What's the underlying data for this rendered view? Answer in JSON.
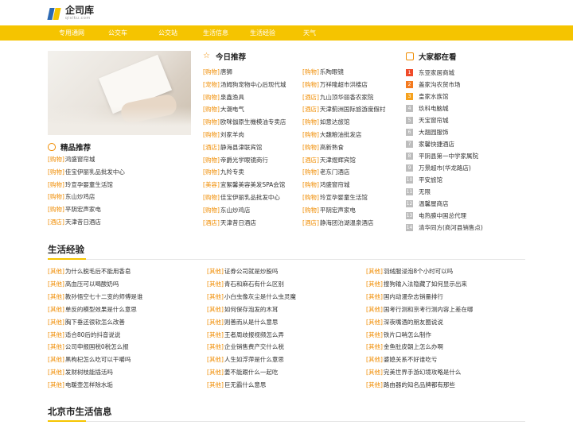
{
  "logo": {
    "title": "企司库",
    "subtitle": "qisiku.com"
  },
  "nav": [
    "专用通网",
    "公交车",
    "公交站",
    "生活信息",
    "生活经验",
    "天气"
  ],
  "jingpin": {
    "title": "精品推荐",
    "items": [
      {
        "tag": "购物",
        "text": "鸿盛窗帘城"
      },
      {
        "tag": "购物",
        "text": "佳宝伊丽乳品批发中心"
      },
      {
        "tag": "购物",
        "text": "玲宣孕婴童生活馆"
      },
      {
        "tag": "购物",
        "text": "东山炒鸡店"
      },
      {
        "tag": "购物",
        "text": "平阴宏声家电"
      },
      {
        "tag": "酒店",
        "text": "天津昔日酒店"
      }
    ]
  },
  "today": {
    "title": "今日推荐",
    "left": [
      {
        "tag": "购物",
        "text": "唐狮"
      },
      {
        "tag": "宠物",
        "text": "汤姆狗宠物中心后现代城"
      },
      {
        "tag": "购物",
        "text": "泉鑫渔具"
      },
      {
        "tag": "购物",
        "text": "大潮电气"
      },
      {
        "tag": "购物",
        "text": "欧咪伽原生機模油专卖店"
      },
      {
        "tag": "购物",
        "text": "刘家羊肉"
      },
      {
        "tag": "酒店",
        "text": "静海县津联宾馆"
      },
      {
        "tag": "购物",
        "text": "帝爵光学眼镜商行"
      },
      {
        "tag": "购物",
        "text": "九羚专卖"
      },
      {
        "tag": "美容",
        "text": "宜絮馨美容美发SPA会馆"
      },
      {
        "tag": "购物",
        "text": "佳宝伊丽乳品批发中心"
      },
      {
        "tag": "购物",
        "text": "东山炒鸡店"
      },
      {
        "tag": "酒店",
        "text": "天津昔日酒店"
      }
    ],
    "right": [
      {
        "tag": "购物",
        "text": "乐陶眼镜"
      },
      {
        "tag": "购物",
        "text": "万祥隆超市洪楼店"
      },
      {
        "tag": "酒店",
        "text": "九山顶华丽香农家院"
      },
      {
        "tag": "酒店",
        "text": "天津蓟洲国际旅游度假村"
      },
      {
        "tag": "购物",
        "text": "如意达旅馆"
      },
      {
        "tag": "购物",
        "text": "大魏粮油批发店"
      },
      {
        "tag": "购物",
        "text": "高新熟食"
      },
      {
        "tag": "酒店",
        "text": "天津煜辉宾馆"
      },
      {
        "tag": "购物",
        "text": "老东门酒店"
      },
      {
        "tag": "购物",
        "text": "鸿盛窗帘城"
      },
      {
        "tag": "购物",
        "text": "玲宣孕婴童生活馆"
      },
      {
        "tag": "购物",
        "text": "平阴宏声家电"
      },
      {
        "tag": "酒店",
        "text": "静海团泊湖温泉酒店"
      }
    ]
  },
  "hot": {
    "title": "大家都在看",
    "items": [
      {
        "n": "1",
        "text": "东亚家居商城"
      },
      {
        "n": "2",
        "text": "盖家沟农贸市场"
      },
      {
        "n": "3",
        "text": "皇家水族馆"
      },
      {
        "n": "4",
        "text": "玖科电脑城"
      },
      {
        "n": "5",
        "text": "天宝窗帘城"
      },
      {
        "n": "6",
        "text": "大翘园服饰"
      },
      {
        "n": "7",
        "text": "家馨快捷酒店"
      },
      {
        "n": "8",
        "text": "平阴县第一中学家属院"
      },
      {
        "n": "9",
        "text": "万景超市(华龙路店)"
      },
      {
        "n": "10",
        "text": "平安旅馆"
      },
      {
        "n": "11",
        "text": "无限"
      },
      {
        "n": "12",
        "text": "温馨屋商店"
      },
      {
        "n": "13",
        "text": "电热膜中国总代理"
      },
      {
        "n": "14",
        "text": "清华同方(商河县销售点)"
      }
    ]
  },
  "life": {
    "title": "生活经验",
    "col1": [
      {
        "tag": "其他",
        "text": "为什么脱毛后不能用香皂"
      },
      {
        "tag": "其他",
        "text": "高血压可以喝酸奶吗"
      },
      {
        "tag": "其他",
        "text": "教孙悟空七十二变的师傅是谁"
      },
      {
        "tag": "其他",
        "text": "单反的模型效果是什么意思"
      },
      {
        "tag": "其他",
        "text": "胸下垂还很软怎么改善"
      },
      {
        "tag": "其他",
        "text": "适合80后的抖音说说"
      },
      {
        "tag": "其他",
        "text": "公司申报国税0税怎么报"
      },
      {
        "tag": "其他",
        "text": "黑枸杞怎么吃可以干嚼吗"
      },
      {
        "tag": "其他",
        "text": "发财树枝能插活吗"
      },
      {
        "tag": "其他",
        "text": "电暖壶怎样除水垢"
      }
    ],
    "col2": [
      {
        "tag": "其他",
        "text": "证券公司就是炒股吗"
      },
      {
        "tag": "其他",
        "text": "青石和麻石有什么区别"
      },
      {
        "tag": "其他",
        "text": "小白虫像灰尘是什么虫灵魔"
      },
      {
        "tag": "其他",
        "text": "如何保存泡发的木耳"
      },
      {
        "tag": "其他",
        "text": "则善而从是什么意思"
      },
      {
        "tag": "其他",
        "text": "王者周歧报视频怎么弄"
      },
      {
        "tag": "其他",
        "text": "企业销售费产交什么税"
      },
      {
        "tag": "其他",
        "text": "人生如浮萍是什么意思"
      },
      {
        "tag": "其他",
        "text": "姜不能跟什么一起吃"
      },
      {
        "tag": "其他",
        "text": "巨无霸什么意思"
      }
    ],
    "col3": [
      {
        "tag": "其他",
        "text": "羽绒服浸泡8个小时可以吗"
      },
      {
        "tag": "其他",
        "text": "搜狗输入法隐藏了如何显示出来"
      },
      {
        "tag": "其他",
        "text": "国内动漫杂志销量排行"
      },
      {
        "tag": "其他",
        "text": "国考行测和京考行测内容上差在哪"
      },
      {
        "tag": "其他",
        "text": "深夜嘴酒的朋友圈说说"
      },
      {
        "tag": "其他",
        "text": "铁片口哨怎么制作"
      },
      {
        "tag": "其他",
        "text": "金鱼肚皮朝上怎么办啊"
      },
      {
        "tag": "其他",
        "text": "婆媳关系不好谁吃亏"
      },
      {
        "tag": "其他",
        "text": "完美世界手游幻境攻略是什么"
      },
      {
        "tag": "其他",
        "text": "路由器的知名品牌都有那些"
      }
    ]
  },
  "beijing": {
    "title": "北京市生活信息"
  },
  "colors": {
    "accent": "#f5c400",
    "tag": "#f08c00",
    "rank1": "#f04b2a",
    "rank2": "#f47a1f",
    "rank3": "#f6a21e"
  }
}
